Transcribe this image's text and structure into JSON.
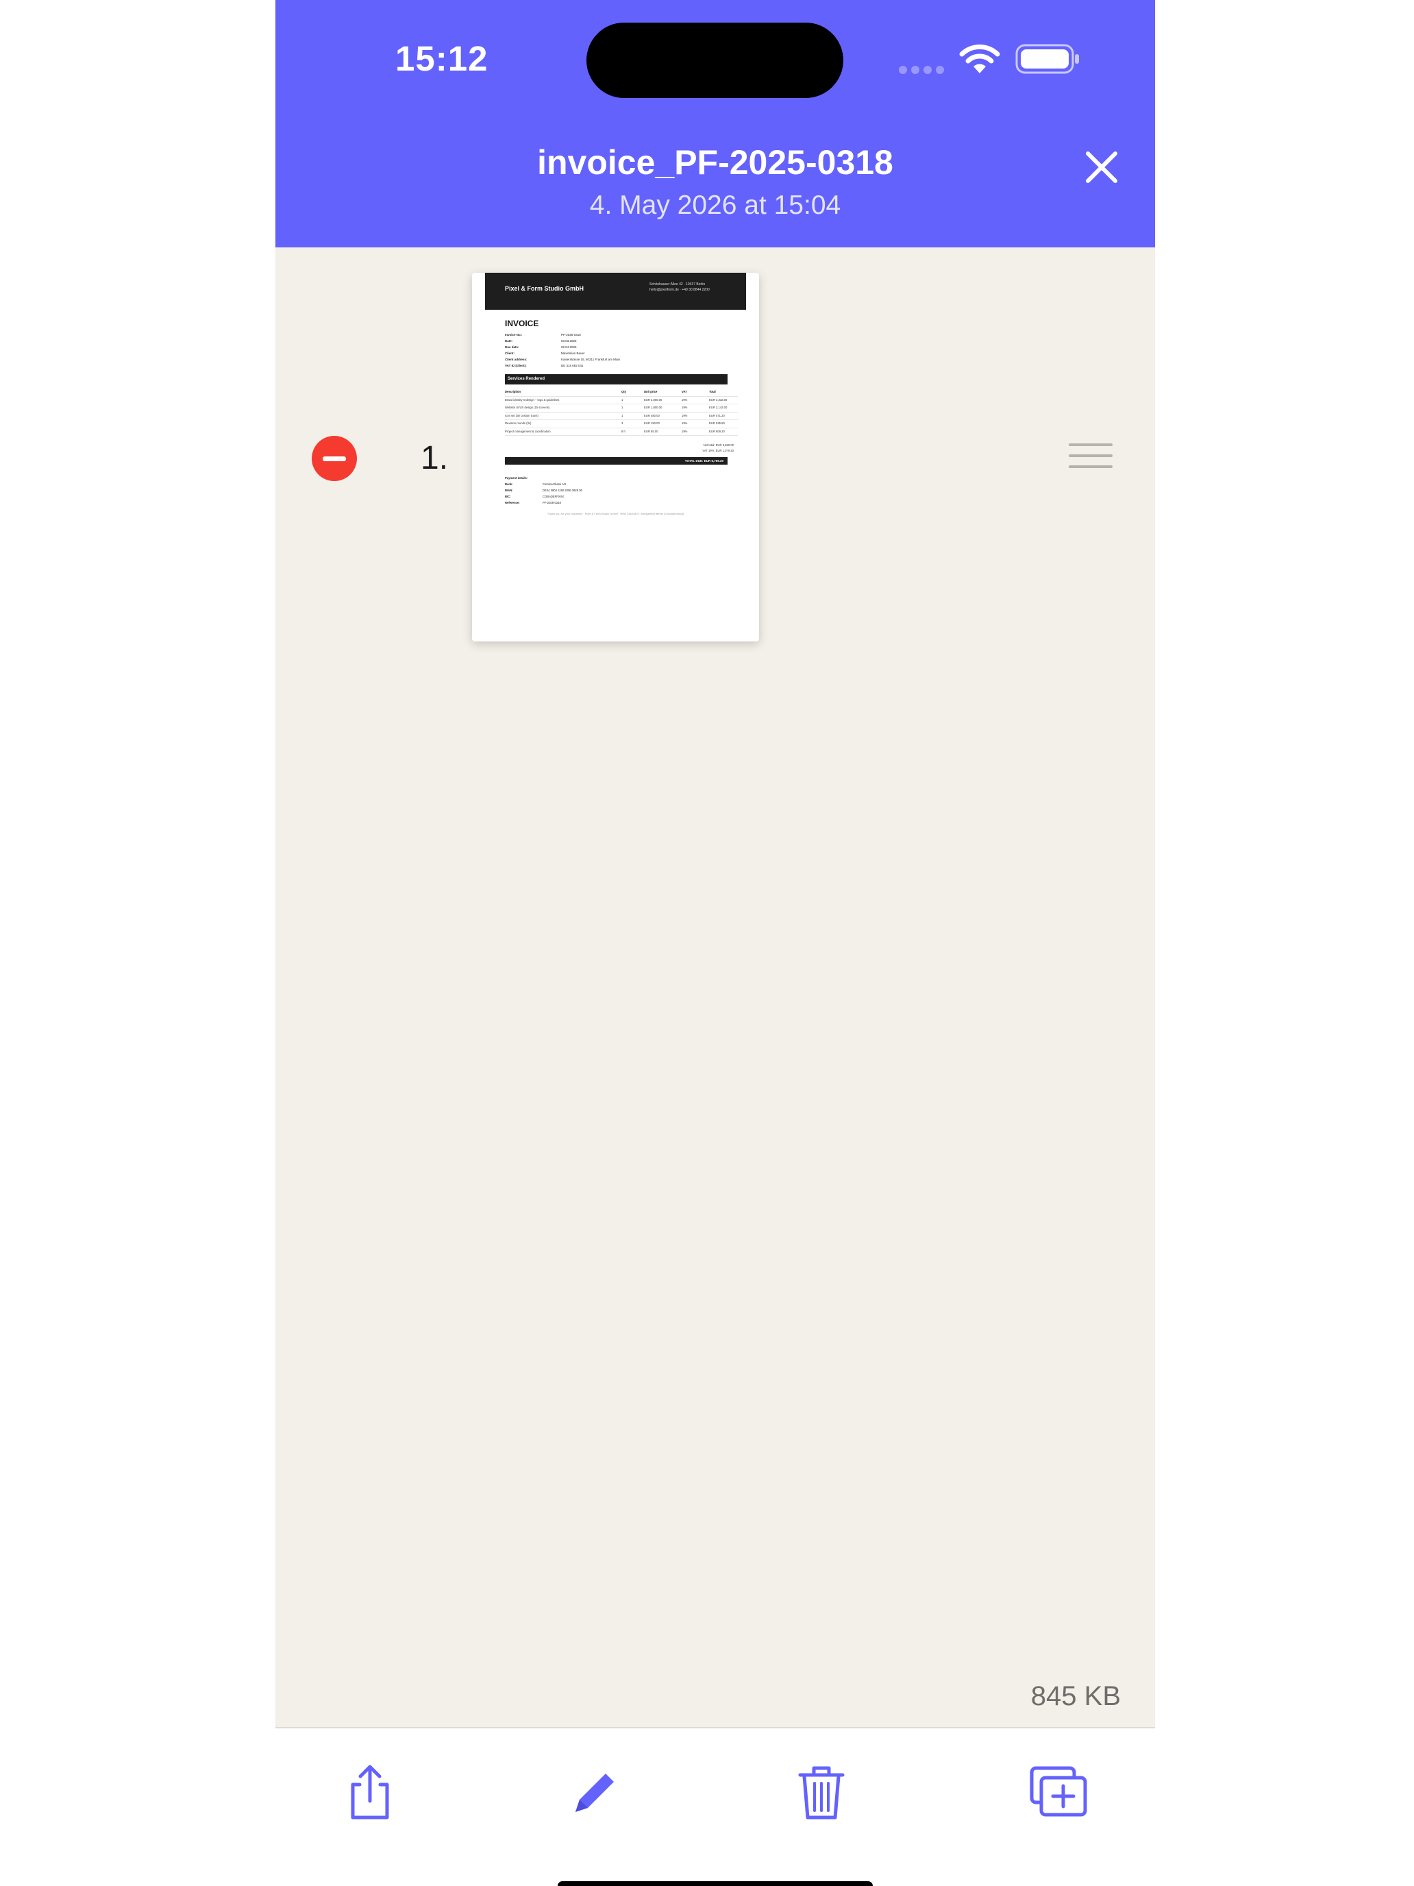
{
  "status_bar": {
    "time": "15:12"
  },
  "header": {
    "title": "invoice_PF-2025-0318",
    "subtitle": "4. May 2026 at 15:04",
    "close_icon": "close-icon"
  },
  "pages": [
    {
      "number": "1.",
      "thumbnail": {
        "company": "Pixel & Form Studio GmbH",
        "address_line1": "Schönhauser Allee 42 · 10437 Berlin",
        "address_line2": "hello@pixelform.de · +49 30 8844 2200",
        "doc_title": "INVOICE",
        "meta": [
          {
            "key": "Invoice No.:",
            "value": "PF-2025-0318"
          },
          {
            "key": "Date:",
            "value": "03.03.2025"
          },
          {
            "key": "Due date:",
            "value": "02.04.2025"
          },
          {
            "key": "Client:",
            "value": "Maximilian Bauer"
          },
          {
            "key": "Client address:",
            "value": "Kaiserstrasse 15, 60311 Frankfurt am Main"
          },
          {
            "key": "VAT ID (client):",
            "value": "DE 315 682 041"
          }
        ],
        "section_title": "Services Rendered",
        "table_headers": [
          "Description",
          "Qty",
          "Unit price",
          "VAT",
          "Total"
        ],
        "rows": [
          [
            "Brand identity redesign – logo & guidelines",
            "1",
            "EUR 2,800.00",
            "19%",
            "EUR 3,332.00"
          ],
          [
            "Website UI/UX design (15 screens)",
            "1",
            "EUR 1,800.00",
            "19%",
            "EUR 2,142.00"
          ],
          [
            "Icon set (30 custom icons)",
            "1",
            "EUR 480.00",
            "19%",
            "EUR 571.20"
          ],
          [
            "Revision rounds (3x)",
            "3",
            "EUR 150.00",
            "19%",
            "EUR 535.50"
          ],
          [
            "Project management & coordination",
            "8 h",
            "EUR 85.00",
            "19%",
            "EUR 809.20"
          ]
        ],
        "net_total_label": "Net total:",
        "net_total": "EUR 5,680.00",
        "vat_label": "VAT 19%:",
        "vat": "EUR 1,079.20",
        "total_label": "TOTAL DUE:",
        "total": "EUR 6,759.20",
        "payment_title": "Payment details:",
        "payment": [
          {
            "key": "Bank:",
            "value": "Commerzbank AG"
          },
          {
            "key": "IBAN:",
            "value": "DE44 3804 1150 2006 3928 00"
          },
          {
            "key": "BIC:",
            "value": "COBADEFFXXX"
          },
          {
            "key": "Reference:",
            "value": "PF-2025-0318"
          }
        ],
        "footer": "Thank you for your business! · Pixel & Form Studio GmbH · HRB 234618 B · Amtsgericht Berlin (Charlottenburg)"
      }
    }
  ],
  "file_size": "845 KB",
  "toolbar": {
    "share_icon": "share-icon",
    "edit_icon": "pencil-icon",
    "delete_icon": "trash-icon",
    "add_icon": "add-page-icon"
  },
  "colors": {
    "header": "#6462fc",
    "content_bg": "#f3efe9",
    "delete": "#f53a30",
    "toolbar_icon": "#6462fc"
  }
}
